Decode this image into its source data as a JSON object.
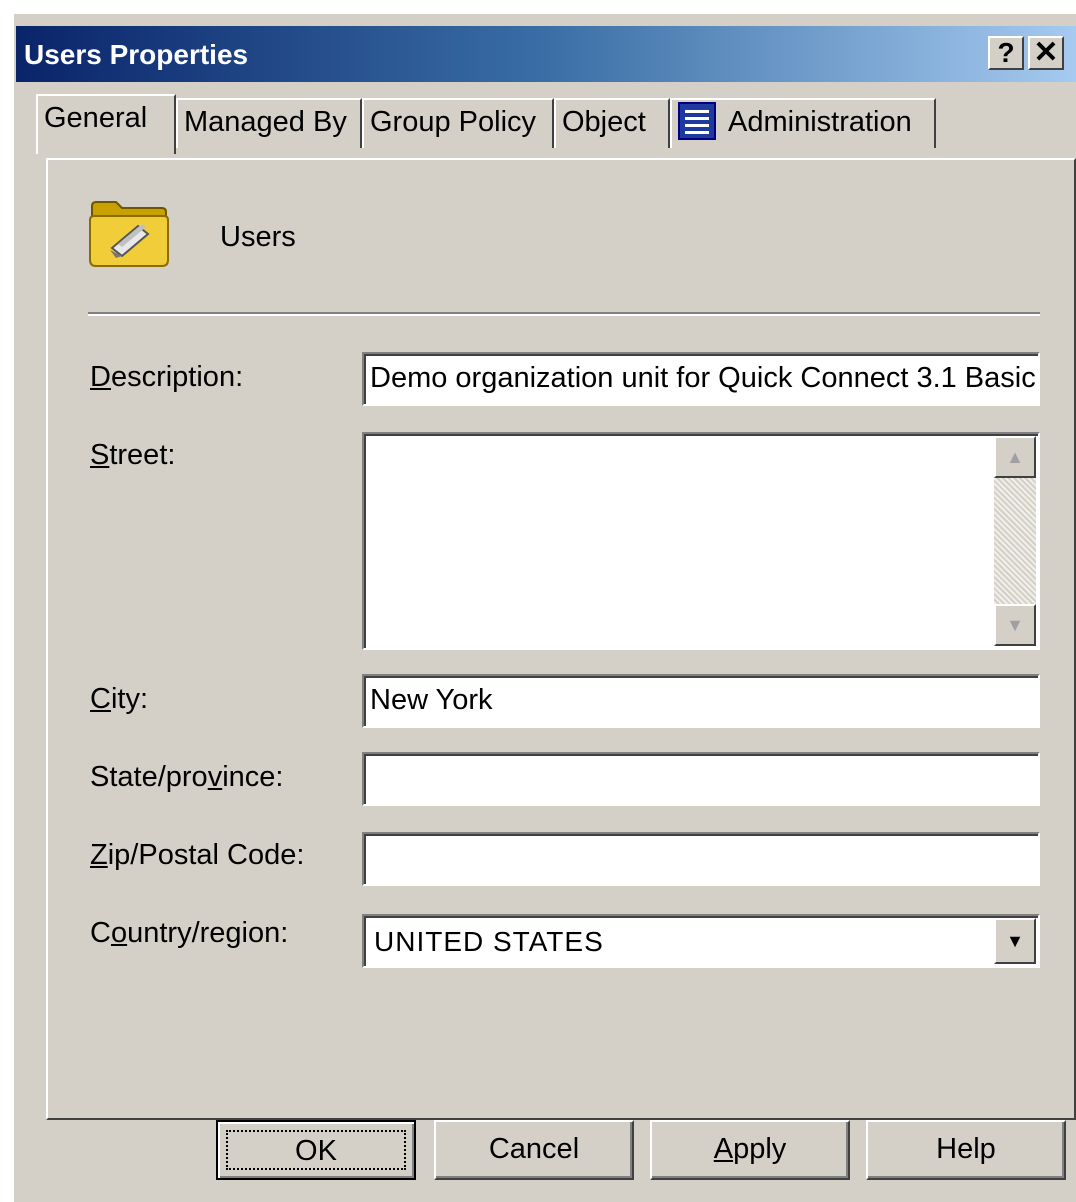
{
  "window": {
    "title": "Users Properties",
    "help_glyph": "?",
    "close_glyph": "✕"
  },
  "tabs": [
    {
      "label": "General",
      "active": true
    },
    {
      "label": "Managed By",
      "active": false
    },
    {
      "label": "Group Policy",
      "active": false
    },
    {
      "label": "Object",
      "active": false
    },
    {
      "label": "Administration",
      "active": false,
      "icon": "administration-icon"
    }
  ],
  "general": {
    "object_name": "Users",
    "object_icon": "folder-icon",
    "fields": {
      "description": {
        "label_pre": "",
        "label_key": "D",
        "label_post": "escription:",
        "value": "Demo organization unit for Quick Connect 3.1 Basic"
      },
      "street": {
        "label_pre": "",
        "label_key": "S",
        "label_post": "treet:",
        "value": ""
      },
      "city": {
        "label_pre": "",
        "label_key": "C",
        "label_post": "ity:",
        "value": "New York"
      },
      "state": {
        "label_pre": "State/pro",
        "label_key": "v",
        "label_post": "ince:",
        "value": ""
      },
      "zip": {
        "label_pre": "",
        "label_key": "Z",
        "label_post": "ip/Postal Code:",
        "value": ""
      },
      "country": {
        "label_pre": "C",
        "label_key": "o",
        "label_post": "untry/region:",
        "value": "UNITED STATES"
      }
    },
    "scroll_up_glyph": "▲",
    "scroll_down_glyph": "▼",
    "dropdown_glyph": "▼"
  },
  "buttons": {
    "ok": "OK",
    "cancel": "Cancel",
    "apply_pre": "",
    "apply_key": "A",
    "apply_post": "pply",
    "help": "Help"
  }
}
